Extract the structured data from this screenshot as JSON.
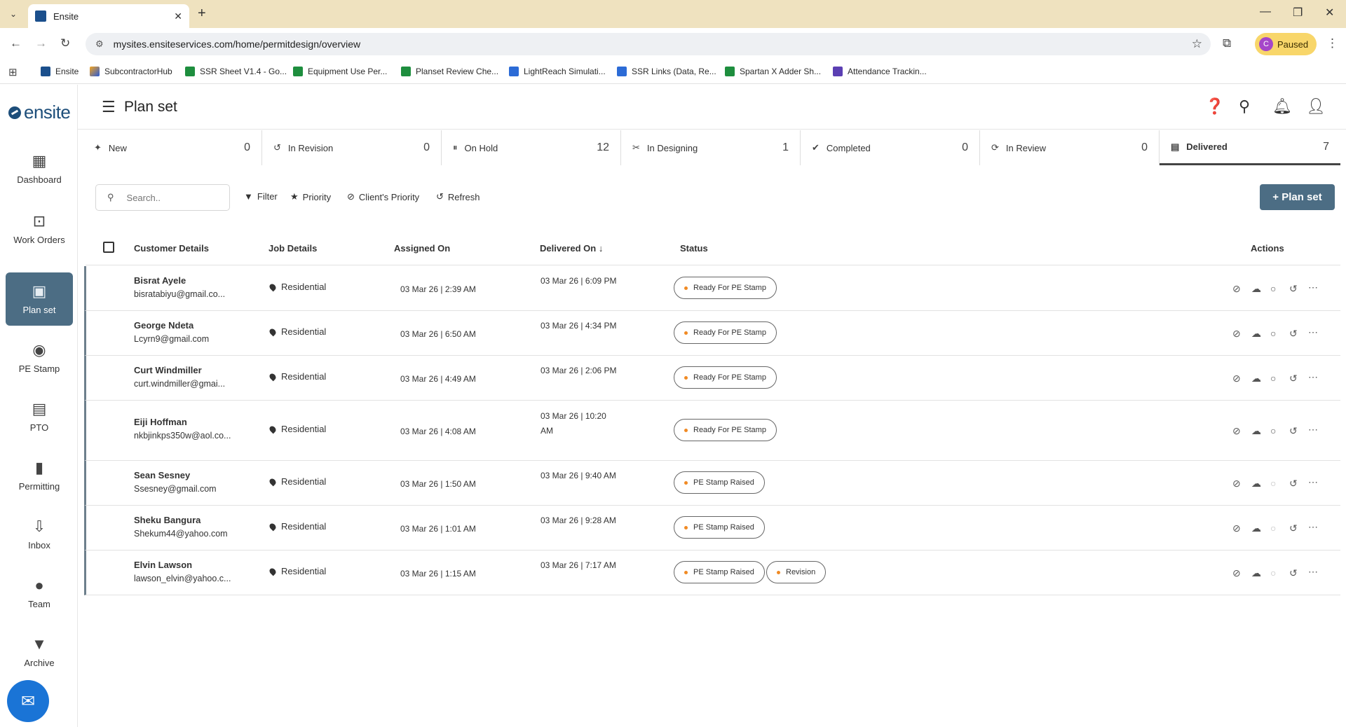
{
  "browser": {
    "tab_title": "Ensite",
    "url": "mysites.ensiteservices.com/home/permitdesign/overview",
    "profile_initial": "C",
    "profile_label": "Paused",
    "bookmarks": [
      {
        "label": "Ensite",
        "color": "navy"
      },
      {
        "label": "SubcontractorHub",
        "color": "orange"
      },
      {
        "label": "SSR Sheet V1.4 - Go...",
        "color": "green"
      },
      {
        "label": "Equipment Use Per...",
        "color": "green"
      },
      {
        "label": "Planset Review Che...",
        "color": "green"
      },
      {
        "label": "LightReach Simulati...",
        "color": "blue"
      },
      {
        "label": "SSR Links (Data, Re...",
        "color": "blue"
      },
      {
        "label": "Spartan X Adder Sh...",
        "color": "green"
      },
      {
        "label": "Attendance Trackin...",
        "color": "purple"
      }
    ]
  },
  "app": {
    "logo": "ensite",
    "page_title": "Plan set",
    "accent_color": "#4c6d84"
  },
  "sidebar": {
    "items": [
      {
        "label": "Dashboard",
        "icon": "dashboard-icon"
      },
      {
        "label": "Work Orders",
        "icon": "work-orders-icon"
      },
      {
        "label": "Plan set",
        "icon": "plan-set-icon",
        "active": true
      },
      {
        "label": "PE Stamp",
        "icon": "pe-stamp-icon"
      },
      {
        "label": "PTO",
        "icon": "pto-icon"
      },
      {
        "label": "Permitting",
        "icon": "permitting-icon"
      },
      {
        "label": "Inbox",
        "icon": "inbox-icon"
      },
      {
        "label": "Team",
        "icon": "team-icon"
      },
      {
        "label": "Archive",
        "icon": "archive-icon"
      }
    ]
  },
  "status_tabs": [
    {
      "label": "New",
      "count": "0"
    },
    {
      "label": "In Revision",
      "count": "0"
    },
    {
      "label": "On Hold",
      "count": "12"
    },
    {
      "label": "In Designing",
      "count": "1"
    },
    {
      "label": "Completed",
      "count": "0"
    },
    {
      "label": "In Review",
      "count": "0"
    },
    {
      "label": "Delivered",
      "count": "7",
      "active": true
    }
  ],
  "filters": {
    "search_placeholder": "Search..",
    "filter_label": "Filter",
    "priority_label": "Priority",
    "client_priority_label": "Client's Priority",
    "refresh_label": "Refresh",
    "add_label": "+ Plan set"
  },
  "table": {
    "columns": {
      "customer": "Customer Details",
      "job": "Job Details",
      "assigned": "Assigned On",
      "delivered": "Delivered On",
      "status": "Status",
      "actions": "Actions"
    },
    "rows": [
      {
        "name": "Bisrat Ayele",
        "email": "bisratabiyu@gmail.co...",
        "job": "Residential",
        "assigned": "03 Mar 26 | 2:39 AM",
        "delivered": "03 Mar 26 | 6:09 PM",
        "statuses": [
          "Ready For PE Stamp"
        ]
      },
      {
        "name": "George Ndeta",
        "email": "Lcyrn9@gmail.com",
        "job": "Residential",
        "assigned": "03 Mar 26 | 6:50 AM",
        "delivered": "03 Mar 26 | 4:34 PM",
        "statuses": [
          "Ready For PE Stamp"
        ]
      },
      {
        "name": "Curt Windmiller",
        "email": "curt.windmiller@gmai...",
        "job": "Residential",
        "assigned": "03 Mar 26 | 4:49 AM",
        "delivered": "03 Mar 26 | 2:06 PM",
        "statuses": [
          "Ready For PE Stamp"
        ]
      },
      {
        "name": "Eiji Hoffman",
        "email": "nkbjinkps350w@aol.co...",
        "job": "Residential",
        "assigned": "03 Mar 26 | 4:08 AM",
        "delivered_line1": "03 Mar 26 | 10:20",
        "delivered_line2": "AM",
        "statuses": [
          "Ready For PE Stamp"
        ]
      },
      {
        "name": "Sean Sesney",
        "email": "Ssesney@gmail.com",
        "job": "Residential",
        "assigned": "03 Mar 26 | 1:50 AM",
        "delivered": "03 Mar 26 | 9:40 AM",
        "statuses": [
          "PE Stamp Raised"
        ]
      },
      {
        "name": "Sheku Bangura",
        "email": "Shekum44@yahoo.com",
        "job": "Residential",
        "assigned": "03 Mar 26 | 1:01 AM",
        "delivered": "03 Mar 26 | 9:28 AM",
        "statuses": [
          "PE Stamp Raised"
        ]
      },
      {
        "name": "Elvin Lawson",
        "email": "lawson_elvin@yahoo.c...",
        "job": "Residential",
        "assigned": "03 Mar 26 | 1:15 AM",
        "delivered": "03 Mar 26 | 7:17 AM",
        "statuses": [
          "PE Stamp Raised",
          "Revision"
        ]
      }
    ]
  }
}
